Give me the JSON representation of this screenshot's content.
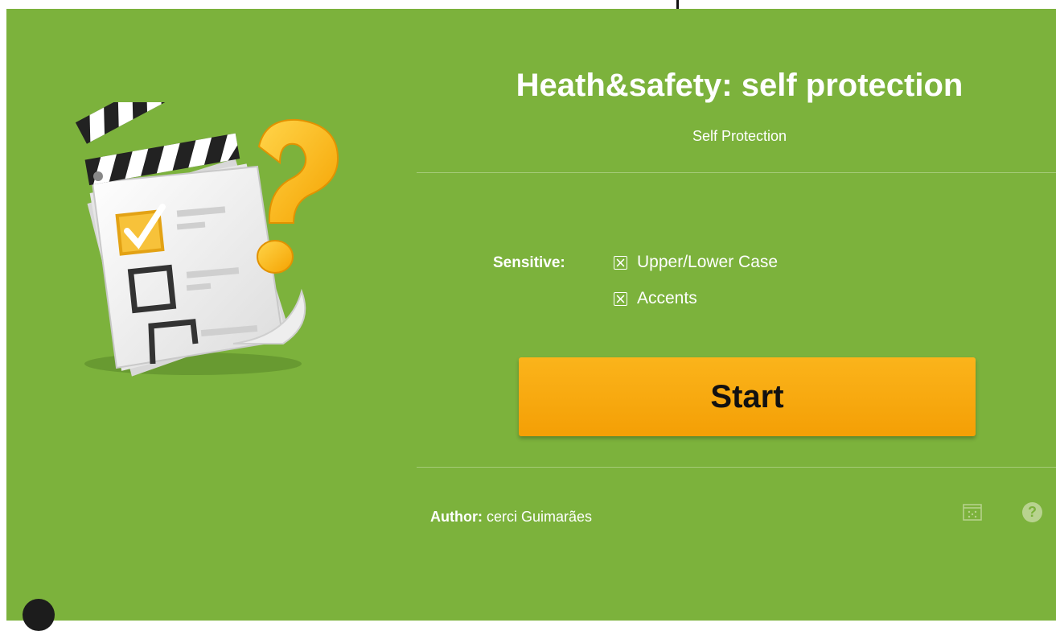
{
  "header": {
    "title": "Heath&safety: self protection",
    "subtitle": "Self Protection"
  },
  "options": {
    "sensitive_label": "Sensitive:",
    "items": [
      {
        "label": "Upper/Lower Case",
        "checked": true
      },
      {
        "label": "Accents",
        "checked": true
      }
    ]
  },
  "start_button": {
    "label": "Start"
  },
  "footer": {
    "author_label": "Author:",
    "author_name": "cerci Guimarães",
    "icons": [
      "random-order-icon",
      "help-icon"
    ],
    "help_glyph": "?"
  },
  "colors": {
    "background": "#7cb23c",
    "button": "#f6a60c",
    "text": "#ffffff"
  }
}
